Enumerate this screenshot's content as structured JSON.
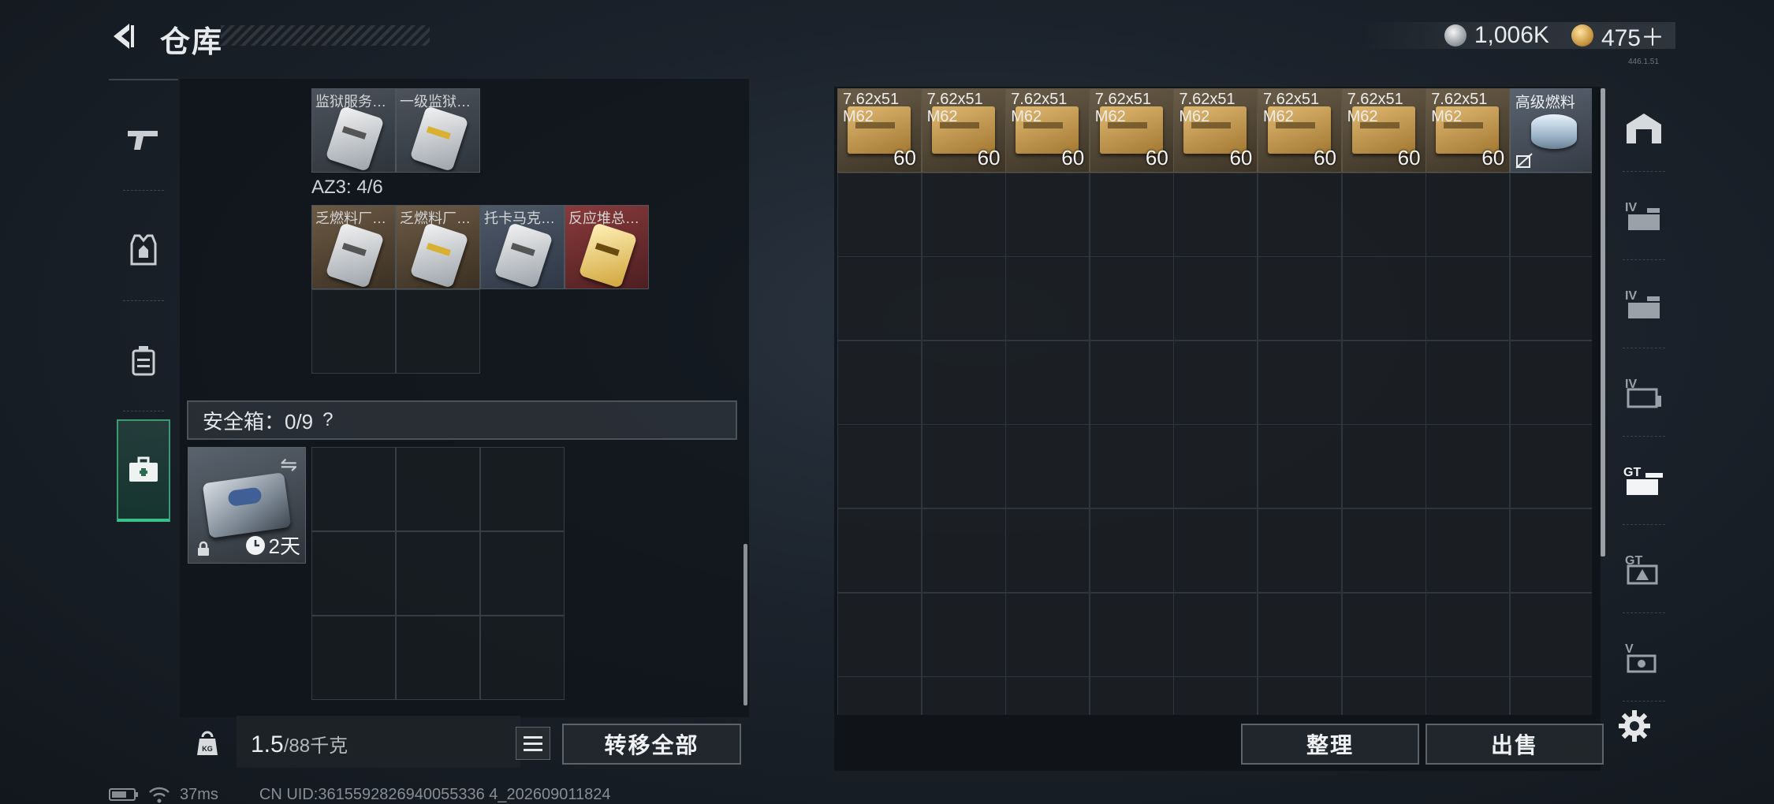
{
  "header": {
    "title": "仓库",
    "currency": [
      {
        "icon": "silver-coin-icon",
        "value": "1,006K"
      },
      {
        "icon": "gold-coin-icon",
        "value": "475＋"
      }
    ],
    "corner_tiny": "446.1.51"
  },
  "left_rail": {
    "items": [
      {
        "name": "weapon",
        "icon": "pistol-icon"
      },
      {
        "name": "armor",
        "icon": "vest-icon"
      },
      {
        "name": "backpack",
        "icon": "backpack-icon"
      },
      {
        "name": "safe-box",
        "icon": "briefcase-icon",
        "active": true
      }
    ]
  },
  "left_panel": {
    "top_items": [
      {
        "label": "监狱服务…",
        "color": "grey",
        "tag": "silver"
      },
      {
        "label": "一级监狱…",
        "color": "grey",
        "tag": "silver-yellow"
      }
    ],
    "az3": {
      "label": "AZ3: 4/6",
      "items": [
        {
          "label": "乏燃料厂…",
          "color": "brown",
          "tag": "silver"
        },
        {
          "label": "乏燃料厂…",
          "color": "brown",
          "tag": "silver-yellow"
        },
        {
          "label": "托卡马克…",
          "color": "blue",
          "tag": "silver"
        },
        {
          "label": "反应堆总…",
          "color": "red",
          "tag": "gold"
        }
      ]
    },
    "safe": {
      "label": "安全箱：0/9",
      "help": "?",
      "box_timer": "2天"
    },
    "weight": {
      "value": "1.5",
      "max": "/88千克"
    },
    "transfer_all": "转移全部"
  },
  "stash": {
    "ammo_items": [
      {
        "line1": "7.62x51",
        "line2": "M62",
        "count": "60"
      },
      {
        "line1": "7.62x51",
        "line2": "M62",
        "count": "60"
      },
      {
        "line1": "7.62x51",
        "line2": "M62",
        "count": "60"
      },
      {
        "line1": "7.62x51",
        "line2": "M62",
        "count": "60"
      },
      {
        "line1": "7.62x51",
        "line2": "M62",
        "count": "60"
      },
      {
        "line1": "7.62x51",
        "line2": "M62",
        "count": "60"
      },
      {
        "line1": "7.62x51",
        "line2": "M62",
        "count": "60"
      },
      {
        "line1": "7.62x51",
        "line2": "M62",
        "count": "60"
      }
    ],
    "fuel_item": {
      "label": "高级燃料"
    },
    "organize": "整理",
    "sell": "出售"
  },
  "right_rail": {
    "icons": [
      "home-icon",
      "storage-iv-icon",
      "storage-iv-2-icon",
      "storage-iv-3-icon",
      "storage-gt-active-icon",
      "storage-gt-icon",
      "storage-v-icon"
    ]
  },
  "status_bar": {
    "ping": "37ms",
    "uid": "CN UID:3615592826940055336 4_202609011824"
  }
}
